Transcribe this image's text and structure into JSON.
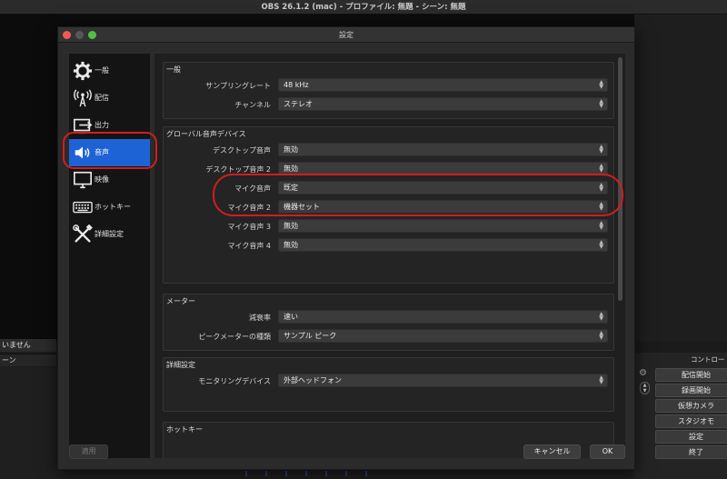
{
  "app": {
    "title": "OBS 26.1.2 (mac) - プロファイル: 無題 - シーン: 無題",
    "scenes_header": "いません",
    "scenes_sub": "ーン",
    "controls_title": "コントロー",
    "controls": [
      "配信開始",
      "録画開始",
      "仮想カメラ",
      "スタジオモ",
      "設定",
      "終了"
    ]
  },
  "dialog": {
    "title": "設定",
    "sidebar": [
      {
        "label": "一般",
        "icon": "gear-icon"
      },
      {
        "label": "配信",
        "icon": "broadcast-icon"
      },
      {
        "label": "出力",
        "icon": "output-icon"
      },
      {
        "label": "音声",
        "icon": "speaker-icon",
        "active": true
      },
      {
        "label": "映像",
        "icon": "monitor-icon"
      },
      {
        "label": "ホットキー",
        "icon": "keyboard-icon"
      },
      {
        "label": "詳細設定",
        "icon": "tools-icon"
      }
    ],
    "sections": {
      "general": {
        "title": "一般",
        "rows": [
          {
            "label": "サンプリングレート",
            "value": "48 kHz"
          },
          {
            "label": "チャンネル",
            "value": "ステレオ"
          }
        ]
      },
      "devices": {
        "title": "グローバル音声デバイス",
        "rows": [
          {
            "label": "デスクトップ音声",
            "value": "無効"
          },
          {
            "label": "デスクトップ音声 2",
            "value": "無効"
          },
          {
            "label": "マイク音声",
            "value": "既定"
          },
          {
            "label": "マイク音声 2",
            "value": "機器セット"
          },
          {
            "label": "マイク音声 3",
            "value": "無効"
          },
          {
            "label": "マイク音声 4",
            "value": "無効"
          }
        ]
      },
      "meters": {
        "title": "メーター",
        "rows": [
          {
            "label": "減衰率",
            "value": "速い"
          },
          {
            "label": "ピークメーターの種類",
            "value": "サンプル ピーク"
          }
        ]
      },
      "advanced": {
        "title": "詳細設定",
        "rows": [
          {
            "label": "モニタリングデバイス",
            "value": "外部ヘッドフォン"
          }
        ]
      },
      "hotkeys": {
        "title": "ホットキー"
      }
    },
    "buttons": {
      "apply": "適用",
      "cancel": "キャンセル",
      "ok": "OK"
    }
  },
  "colors": {
    "accent": "#1e63d6",
    "annotation": "#d21d1d"
  }
}
